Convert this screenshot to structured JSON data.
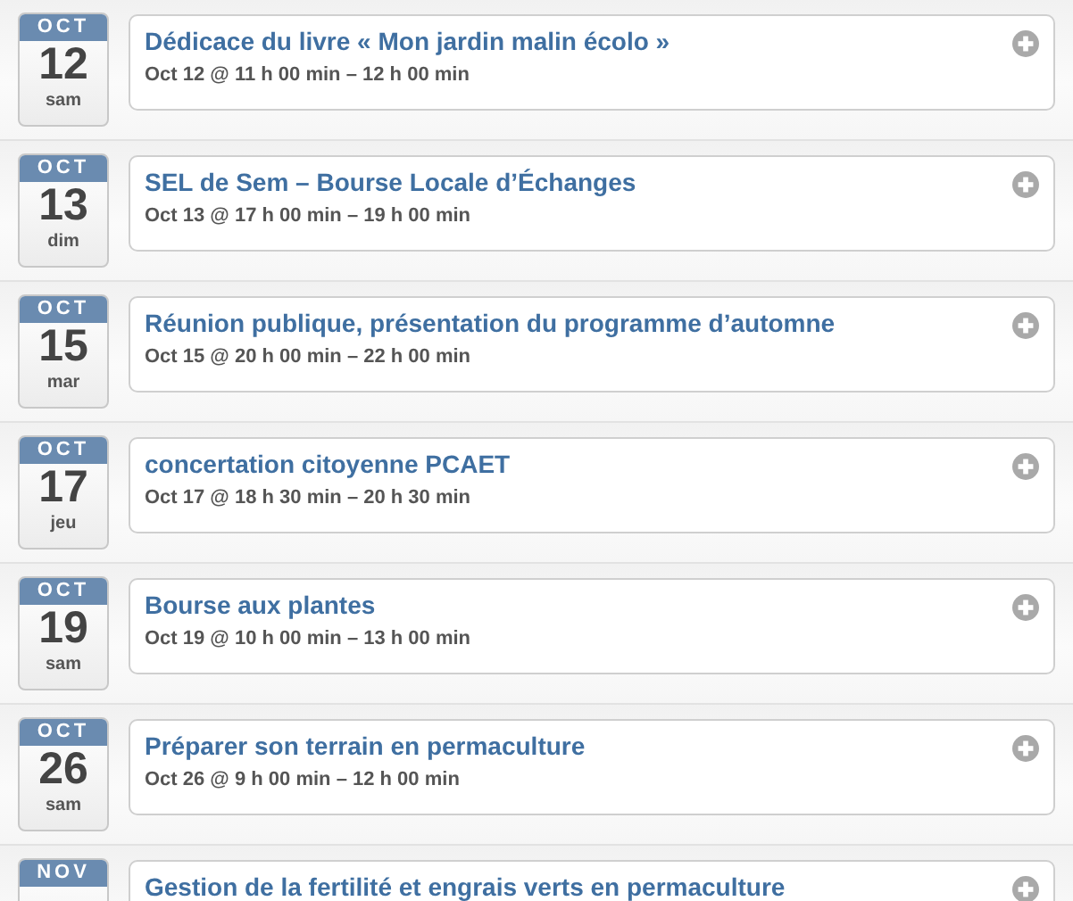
{
  "events": [
    {
      "month": "OCT",
      "day": "12",
      "weekday": "sam",
      "title": "Dédicace du livre « Mon jardin malin écolo »",
      "time": "Oct 12 @ 11 h 00 min – 12 h 00 min"
    },
    {
      "month": "OCT",
      "day": "13",
      "weekday": "dim",
      "title": "SEL de Sem – Bourse Locale d’Échanges",
      "time": "Oct 13 @ 17 h 00 min – 19 h 00 min"
    },
    {
      "month": "OCT",
      "day": "15",
      "weekday": "mar",
      "title": "Réunion publique, présentation du programme d’automne",
      "time": "Oct 15 @ 20 h 00 min – 22 h 00 min"
    },
    {
      "month": "OCT",
      "day": "17",
      "weekday": "jeu",
      "title": "concertation citoyenne PCAET",
      "time": "Oct 17 @ 18 h 30 min – 20 h 30 min"
    },
    {
      "month": "OCT",
      "day": "19",
      "weekday": "sam",
      "title": "Bourse aux plantes",
      "time": "Oct 19 @ 10 h 00 min – 13 h 00 min"
    },
    {
      "month": "OCT",
      "day": "26",
      "weekday": "sam",
      "title": "Préparer son terrain en permaculture",
      "time": "Oct 26 @ 9 h 00 min – 12 h 00 min"
    },
    {
      "month": "NOV",
      "title": "Gestion de la fertilité et engrais verts en permaculture"
    }
  ]
}
